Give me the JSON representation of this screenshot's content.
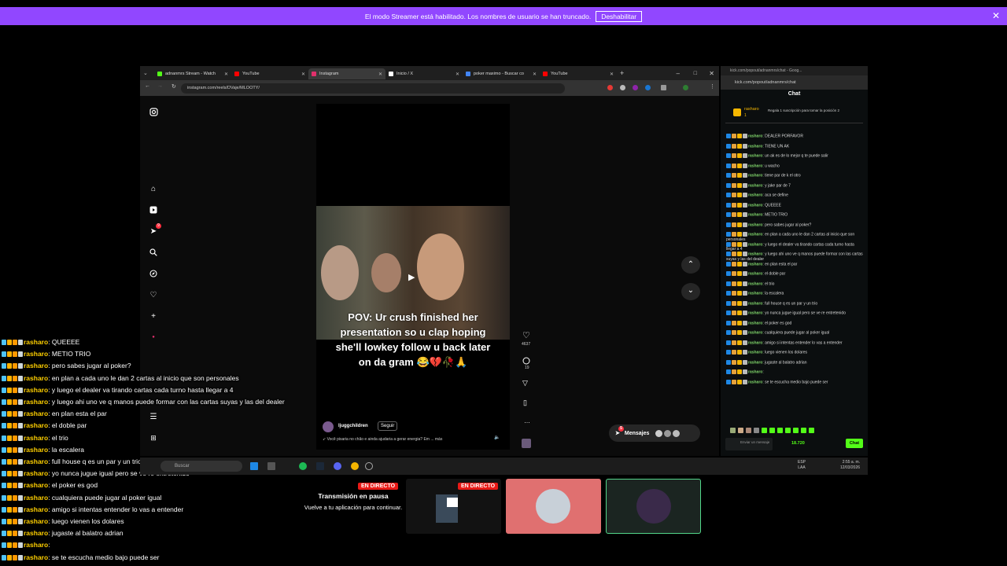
{
  "banner": {
    "text": "El modo Streamer está habilitado. Los nombres de usuario se han truncado.",
    "button": "Deshabilitar",
    "close": "✕"
  },
  "browser": {
    "tabs": [
      {
        "label": "adnanmrs Stream - Watch",
        "color": "#53fc18"
      },
      {
        "label": "YouTube",
        "color": "#ff0000"
      },
      {
        "label": "Instagram",
        "color": "#e1306c"
      },
      {
        "label": "Inicio / X",
        "color": "#ffffff"
      },
      {
        "label": "poker maximo - Buscar co",
        "color": "#4285f4"
      },
      {
        "label": "YouTube",
        "color": "#ff0000"
      }
    ],
    "url": "instagram.com/reels/DVaje/MLOOTY/"
  },
  "instagram": {
    "caption": "POV: Ur crush finished her presentation so u clap hoping she'll lowkey follow u back later on da gram 😂💔🥀🙏",
    "likes": "4637",
    "comments": "19",
    "author": "ljuggchildren",
    "follow": "Seguir",
    "description": "➶ Você pisaria no chão e ainda ajudaria a gerar energia? Em ... más",
    "messages": "Mensajes",
    "notif_count": "9",
    "msg_count": "5"
  },
  "kick": {
    "url": "kick.com/popout/adnanmrs/chat - Goog...",
    "url2": "kick.com/popout/adnanmrs/chat",
    "title": "Chat",
    "pinned_user": "rasharo",
    "pinned_text": "Regala 1 suscripción para tomar la posición 2",
    "pinned_count": "1",
    "messages": [
      {
        "user": "rasharo",
        "text": "DEALER PORFAVOR"
      },
      {
        "user": "rasharo",
        "text": "TIENE UN AK"
      },
      {
        "user": "rasharo",
        "text": "un ak es de lo mejor q te puede salir"
      },
      {
        "user": "rasharo",
        "text": "u wacho"
      },
      {
        "user": "rasharo",
        "text": "tiene par de k el otro"
      },
      {
        "user": "rasharo",
        "text": "y jake par de 7"
      },
      {
        "user": "rasharo",
        "text": "aca se define"
      },
      {
        "user": "rasharo",
        "text": "QUEEEE"
      },
      {
        "user": "rasharo",
        "text": "METIO TRIO"
      },
      {
        "user": "rasharo",
        "text": "pero sabes jugar al poker?"
      },
      {
        "user": "rasharo",
        "text": "en plan a cada uno le dan 2 cartas al inicio que son personales"
      },
      {
        "user": "rasharo",
        "text": "y luego el dealer va tirando cartas cada turno hasta llegar a 4"
      },
      {
        "user": "rasharo",
        "text": "y luego ahi uno ve q manos puede formar con las cartas suyas y las del dealer"
      },
      {
        "user": "rasharo",
        "text": "en plan esta el par"
      },
      {
        "user": "rasharo",
        "text": "el doble par"
      },
      {
        "user": "rasharo",
        "text": "el trio"
      },
      {
        "user": "rasharo",
        "text": "la escalera"
      },
      {
        "user": "rasharo",
        "text": "full house q es un par y un trio"
      },
      {
        "user": "rasharo",
        "text": "yo nunca jugue igual pero se ve re entretenido"
      },
      {
        "user": "rasharo",
        "text": "el poker es god"
      },
      {
        "user": "rasharo",
        "text": "cualquiera puede jugar al poker igual"
      },
      {
        "user": "rasharo",
        "text": "amigo si intentas entender lo vas a entender"
      },
      {
        "user": "rasharo",
        "text": "luego vienen los dolares"
      },
      {
        "user": "rasharo",
        "text": "jugaste al balatro adrian"
      },
      {
        "user": "rasharo",
        "text": ""
      },
      {
        "user": "rasharo",
        "text": "se te escucha medio bajo puede ser"
      }
    ],
    "input_placeholder": "Enviar un mensaje",
    "points": "18.720",
    "send": "Chat"
  },
  "overlay_chat": [
    {
      "user": "rasharo",
      "text": "QUEEEE"
    },
    {
      "user": "rasharo",
      "text": "METIO TRIO"
    },
    {
      "user": "rasharo",
      "text": "pero sabes jugar al poker?"
    },
    {
      "user": "rasharo",
      "text": "en plan a cada uno le dan 2 cartas al inicio que son personales"
    },
    {
      "user": "rasharo",
      "text": "y luego el dealer va tirando cartas cada turno hasta llegar a 4"
    },
    {
      "user": "rasharo",
      "text": "y luego ahi uno ve q manos puede formar con las cartas suyas y las del dealer"
    },
    {
      "user": "rasharo",
      "text": "en plan esta el par"
    },
    {
      "user": "rasharo",
      "text": "el doble par"
    },
    {
      "user": "rasharo",
      "text": "el trio"
    },
    {
      "user": "rasharo",
      "text": "la escalera"
    },
    {
      "user": "rasharo",
      "text": "full house q es un par y un trio"
    },
    {
      "user": "rasharo",
      "text": "yo nunca jugue igual pero se ve re entretenido"
    },
    {
      "user": "rasharo",
      "text": "el poker es god"
    },
    {
      "user": "rasharo",
      "text": "cualquiera puede jugar al poker igual"
    },
    {
      "user": "rasharo",
      "text": "amigo si intentas entender lo vas a entender"
    },
    {
      "user": "rasharo",
      "text": "luego vienen los dolares"
    },
    {
      "user": "rasharo",
      "text": "jugaste al balatro adrian"
    },
    {
      "user": "rasharo",
      "text": ""
    },
    {
      "user": "rasharo",
      "text": "se te escucha medio bajo puede ser"
    }
  ],
  "taskbar": {
    "search": "Buscar",
    "lang": "ESP",
    "lang2": "LAA",
    "time": "2:55 a. m.",
    "date": "12/03/2026"
  },
  "bottom": {
    "live1": "EN DIRECTO",
    "live2": "EN DIRECTO",
    "pause_title": "Transmisión en pausa",
    "pause_text": "Vuelve a tu aplicación para continuar."
  }
}
